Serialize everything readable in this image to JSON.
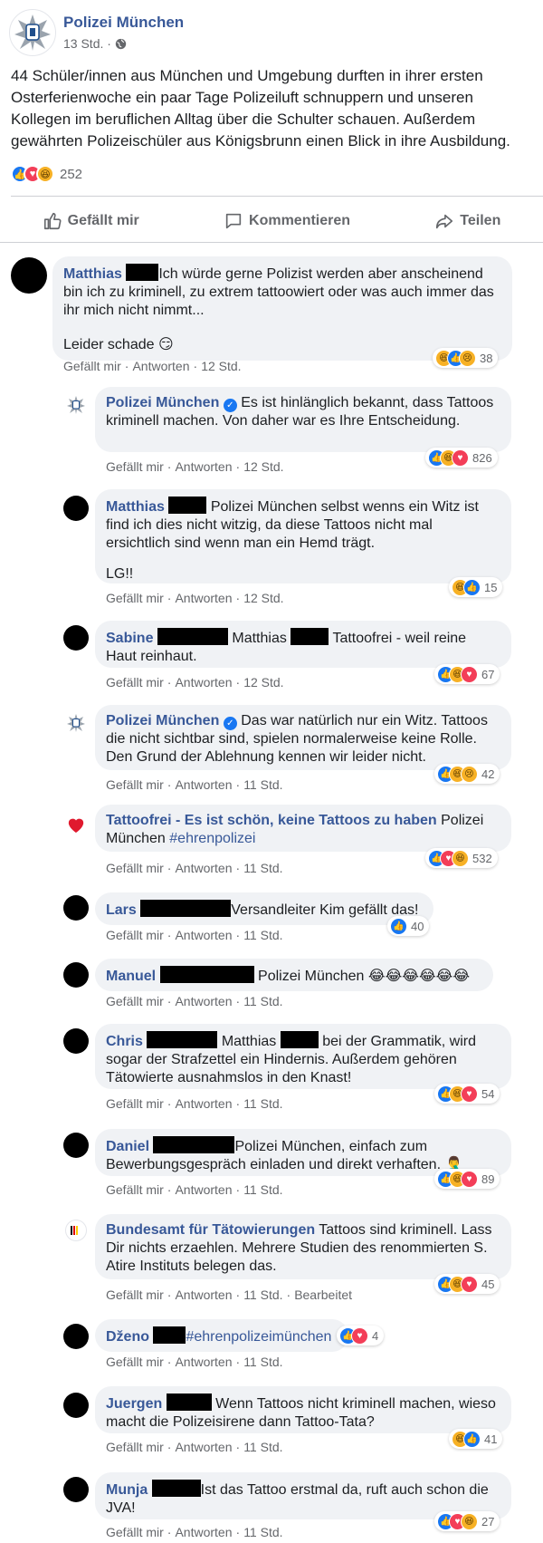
{
  "post": {
    "page_name": "Polizei München",
    "time": "13 Std.",
    "privacy_icon": "globe-icon",
    "text": "44 Schüler/innen aus München und Umgebung durften in ihrer ersten Osterferienwoche ein paar Tage Polizeiluft schnuppern und unseren Kollegen im beruflichen Alltag über die Schulter schauen. Außerdem gewährten Polizeischüler aus Königsbrunn einen Blick in ihre Ausbildung.",
    "reactions_count": "252",
    "actions": {
      "like": "Gefällt mir",
      "comment": "Kommentieren",
      "share": "Teilen"
    }
  },
  "comment_actions": {
    "like": "Gefällt mir",
    "reply": "Antworten",
    "edited": "Bearbeitet"
  },
  "comments": {
    "c1": {
      "author": "Matthias",
      "text1": "Ich würde gerne Polizist werden aber anscheinend bin ich zu kriminell, zu extrem tattoowiert oder was auch immer das ihr mich nicht nimmt...",
      "text2": "Leider schade 😏",
      "time": "12 Std.",
      "count": "38"
    },
    "c2": {
      "author": "Polizei München",
      "text": "Es ist hinlänglich bekannt, dass Tattoos kriminell machen. Von daher war es Ihre Entscheidung.",
      "time": "12 Std.",
      "count": "826"
    },
    "c3": {
      "author": "Matthias",
      "text1": "Polizei München selbst wenns ein Witz ist find ich dies nicht witzig, da diese Tattoos nicht mal ersichtlich sind wenn man ein Hemd trägt.",
      "text2": "LG!!",
      "time": "12 Std.",
      "count": "15"
    },
    "c4": {
      "author": "Sabine",
      "mention": "Matthias",
      "text": "Tattoofrei - weil reine Haut reinhaut.",
      "time": "12 Std.",
      "count": "67"
    },
    "c5": {
      "author": "Polizei München",
      "text": "Das war natürlich nur ein Witz. Tattoos die nicht sichtbar sind, spielen normalerweise keine Rolle. Den Grund der Ablehnung kennen wir leider nicht.",
      "time": "11 Std.",
      "count": "42"
    },
    "c6": {
      "author": "Tattoofrei - Es ist schön, keine Tattoos zu haben",
      "text": "Polizei München",
      "hashtag": "#ehrenpolizei",
      "time": "11 Std.",
      "count": "532"
    },
    "c7": {
      "author": "Lars",
      "text": "Versandleiter Kim gefällt das!",
      "time": "11 Std.",
      "count": "40"
    },
    "c8": {
      "author": "Manuel",
      "text": "Polizei München 😂😂😂😂😂😂",
      "time": "11 Std."
    },
    "c9": {
      "author": "Chris",
      "mention": "Matthias",
      "text": "bei der Grammatik, wird sogar der Strafzettel ein Hindernis. Außerdem gehören Tätowierte ausnahmslos in den Knast!",
      "time": "11 Std.",
      "count": "54"
    },
    "c10": {
      "author": "Daniel",
      "text": "Polizei München, einfach zum Bewerbungsgespräch einladen und direkt verhaften. 🤦‍♂️",
      "time": "11 Std.",
      "count": "89"
    },
    "c11": {
      "author": "Bundesamt für Tätowierungen",
      "text": "Tattoos sind kriminell. Lass Dir nichts erzaehlen. Mehrere Studien des renommierten S. Atire Instituts belegen das.",
      "time": "11 Std.",
      "count": "45"
    },
    "c12": {
      "author": "Dženo",
      "hashtag": "#ehrenpolizeimünchen",
      "time": "11 Std.",
      "count": "4"
    },
    "c13": {
      "author": "Juergen",
      "text": "Wenn Tattoos nicht kriminell machen, wieso macht die Polizeisirene dann Tattoo-Tata?",
      "time": "11 Std.",
      "count": "41"
    },
    "c14": {
      "author": "Munja",
      "text": "Ist das Tattoo erstmal da, ruft auch schon die JVA!",
      "time": "11 Std.",
      "count": "27"
    }
  },
  "colors": {
    "link": "#385898",
    "bubble": "#f0f2f5",
    "like": "#1877f2",
    "love": "#f33e58",
    "haha": "#f7b125",
    "meta": "#65676b"
  }
}
